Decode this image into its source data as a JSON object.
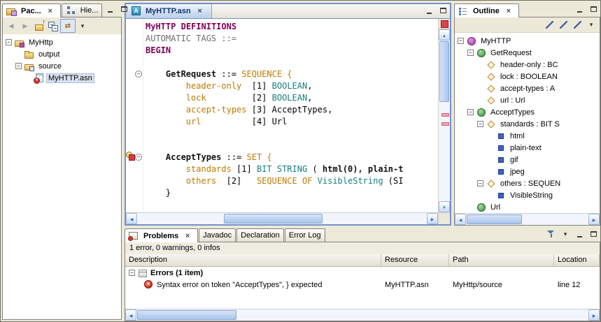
{
  "left_panel": {
    "tabs": [
      {
        "label": "Pac..."
      },
      {
        "label": "Hie..."
      }
    ],
    "window_buttons": [
      "minimize",
      "maximize"
    ],
    "toolbar": [
      "back",
      "forward",
      "up-level",
      "collapse-all",
      "link-with-editor",
      "view-menu"
    ],
    "tree": [
      {
        "label": "MyHttp",
        "level": 0,
        "icon": "project",
        "expander": true
      },
      {
        "label": "output",
        "level": 1,
        "icon": "folder",
        "expander": false
      },
      {
        "label": "source",
        "level": 1,
        "icon": "srcfolder",
        "expander": true
      },
      {
        "label": "MyHTTP.asn",
        "level": 2,
        "icon": "file-error",
        "expander": false,
        "selected": true
      }
    ]
  },
  "editor": {
    "tab_label": "MyHTTP.asn",
    "window_buttons": [
      "minimize",
      "maximize"
    ],
    "code_lines": [
      {
        "tokens": [
          {
            "t": "MyHTTP",
            "s": "kw"
          },
          {
            "t": " ",
            "s": "plain"
          },
          {
            "t": "DEFINITIONS",
            "s": "kw"
          }
        ]
      },
      {
        "tokens": [
          {
            "t": "AUTOMATIC TAGS ::=",
            "s": "gray"
          }
        ]
      },
      {
        "tokens": [
          {
            "t": "BEGIN",
            "s": "kw"
          }
        ]
      },
      {
        "tokens": []
      },
      {
        "tokens": [
          {
            "t": "    ",
            "s": "plain"
          },
          {
            "t": "GetRequest",
            "s": "def"
          },
          {
            "t": " ::= ",
            "s": "plain"
          },
          {
            "t": "SEQUENCE {",
            "s": "orange"
          }
        ]
      },
      {
        "tokens": [
          {
            "t": "        ",
            "s": "plain"
          },
          {
            "t": "header-only",
            "s": "orange"
          },
          {
            "t": "  [1] ",
            "s": "plain"
          },
          {
            "t": "BOOLEAN",
            "s": "type"
          },
          {
            "t": ",",
            "s": "plain"
          }
        ]
      },
      {
        "tokens": [
          {
            "t": "        ",
            "s": "plain"
          },
          {
            "t": "lock",
            "s": "orange"
          },
          {
            "t": "         [2] ",
            "s": "plain"
          },
          {
            "t": "BOOLEAN",
            "s": "type"
          },
          {
            "t": ",",
            "s": "plain"
          }
        ]
      },
      {
        "tokens": [
          {
            "t": "        ",
            "s": "plain"
          },
          {
            "t": "accept-types",
            "s": "orange"
          },
          {
            "t": " [3] ",
            "s": "plain"
          },
          {
            "t": "AcceptTypes,",
            "s": "plain"
          }
        ]
      },
      {
        "tokens": [
          {
            "t": "        ",
            "s": "plain"
          },
          {
            "t": "url",
            "s": "orange"
          },
          {
            "t": "          [4] ",
            "s": "plain"
          },
          {
            "t": "Url",
            "s": "plain"
          }
        ]
      },
      {
        "tokens": []
      },
      {
        "tokens": []
      },
      {
        "tokens": [
          {
            "t": "    ",
            "s": "plain"
          },
          {
            "t": "AcceptTypes",
            "s": "def"
          },
          {
            "t": " ::= ",
            "s": "plain"
          },
          {
            "t": "SET {",
            "s": "orange"
          }
        ]
      },
      {
        "tokens": [
          {
            "t": "        ",
            "s": "plain"
          },
          {
            "t": "standards",
            "s": "orange"
          },
          {
            "t": " [1] ",
            "s": "plain"
          },
          {
            "t": "BIT STRING",
            "s": "type"
          },
          {
            "t": " ( ",
            "s": "plain"
          },
          {
            "t": "html(0), plain-t",
            "s": "bold"
          }
        ]
      },
      {
        "tokens": [
          {
            "t": "        ",
            "s": "plain"
          },
          {
            "t": "others",
            "s": "orange"
          },
          {
            "t": "  [2]   ",
            "s": "plain"
          },
          {
            "t": "SEQUENCE OF ",
            "s": "orange"
          },
          {
            "t": "VisibleString",
            "s": "type"
          },
          {
            "t": " (SI",
            "s": "plain"
          }
        ]
      },
      {
        "tokens": [
          {
            "t": "    }",
            "s": "plain"
          }
        ]
      }
    ]
  },
  "outline": {
    "tab_label": "Outline",
    "window_buttons": [
      "minimize",
      "maximize"
    ],
    "toolbar": [
      "sort",
      "hide-fields",
      "hide-values",
      "view-menu"
    ],
    "tree": [
      {
        "label": "MyHTTP",
        "level": 0,
        "icon": "module",
        "expander": true
      },
      {
        "label": "GetRequest",
        "level": 1,
        "icon": "type",
        "expander": true
      },
      {
        "label": "header-only : BC",
        "level": 2,
        "icon": "field",
        "expander": false
      },
      {
        "label": "lock : BOOLEAN",
        "level": 2,
        "icon": "field",
        "expander": false
      },
      {
        "label": "accept-types : A",
        "level": 2,
        "icon": "field",
        "expander": false
      },
      {
        "label": "url : Url",
        "level": 2,
        "icon": "field",
        "expander": false
      },
      {
        "label": "AcceptTypes",
        "level": 1,
        "icon": "type",
        "expander": true
      },
      {
        "label": "standards : BIT S",
        "level": 2,
        "icon": "field",
        "expander": true
      },
      {
        "label": "html",
        "level": 3,
        "icon": "value",
        "expander": false
      },
      {
        "label": "plain-text",
        "level": 3,
        "icon": "value",
        "expander": false
      },
      {
        "label": "gif",
        "level": 3,
        "icon": "value",
        "expander": false
      },
      {
        "label": "jpeg",
        "level": 3,
        "icon": "value",
        "expander": false
      },
      {
        "label": "others : SEQUEN",
        "level": 2,
        "icon": "field",
        "expander": true
      },
      {
        "label": "VisibleString",
        "level": 3,
        "icon": "value",
        "expander": false
      },
      {
        "label": "Url",
        "level": 1,
        "icon": "type",
        "expander": false
      }
    ]
  },
  "problems": {
    "tabs": [
      {
        "label": "Problems"
      },
      {
        "label": "Javadoc"
      },
      {
        "label": "Declaration"
      },
      {
        "label": "Error Log"
      }
    ],
    "toolbar": [
      "filter",
      "view-menu",
      "minimize",
      "maximize"
    ],
    "summary": "1 error, 0 warnings, 0 infos",
    "columns": [
      "Description",
      "Resource",
      "Path",
      "Location"
    ],
    "group_row": {
      "label": "Errors (1 item)"
    },
    "error_row": {
      "description": "Syntax error on token \"AcceptTypes\", } expected",
      "resource": "MyHTTP.asn",
      "path": "MyHttp/source",
      "location": "line 12"
    }
  },
  "colors": {
    "keyword": "#7F0055",
    "field_orange": "#BF7900",
    "builtin_type_teal": "#177E7E",
    "comment_gray": "#6E6E6E",
    "error_red": "#C41E14",
    "active_part_border": "#7593C9",
    "window_background": "#ECE9D8"
  }
}
